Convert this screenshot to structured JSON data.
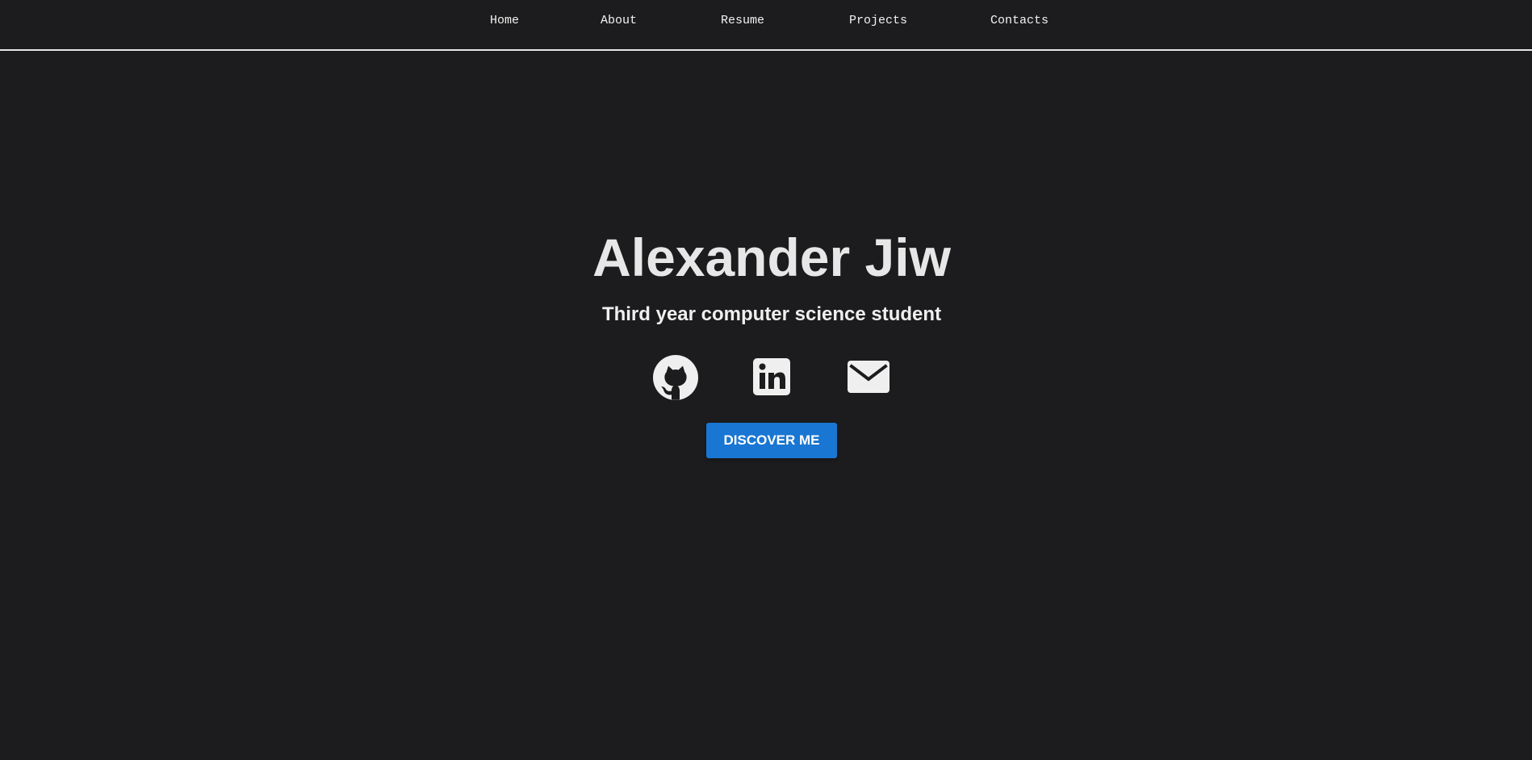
{
  "theme": {
    "background": "#1c1c1e",
    "text": "#ececec",
    "nav_border": "#e6e6e6",
    "button_blue": "#1976d2"
  },
  "navigation": {
    "items": [
      {
        "label": "Home"
      },
      {
        "label": "About"
      },
      {
        "label": "Resume"
      },
      {
        "label": "Projects"
      },
      {
        "label": "Contacts"
      }
    ]
  },
  "hero": {
    "name": "Alexander Jiw",
    "subtitle": "Third year computer science student",
    "button_label": "DISCOVER ME",
    "social_icons": [
      {
        "icon": "github-icon"
      },
      {
        "icon": "linkedin-icon"
      },
      {
        "icon": "email-icon"
      }
    ]
  }
}
